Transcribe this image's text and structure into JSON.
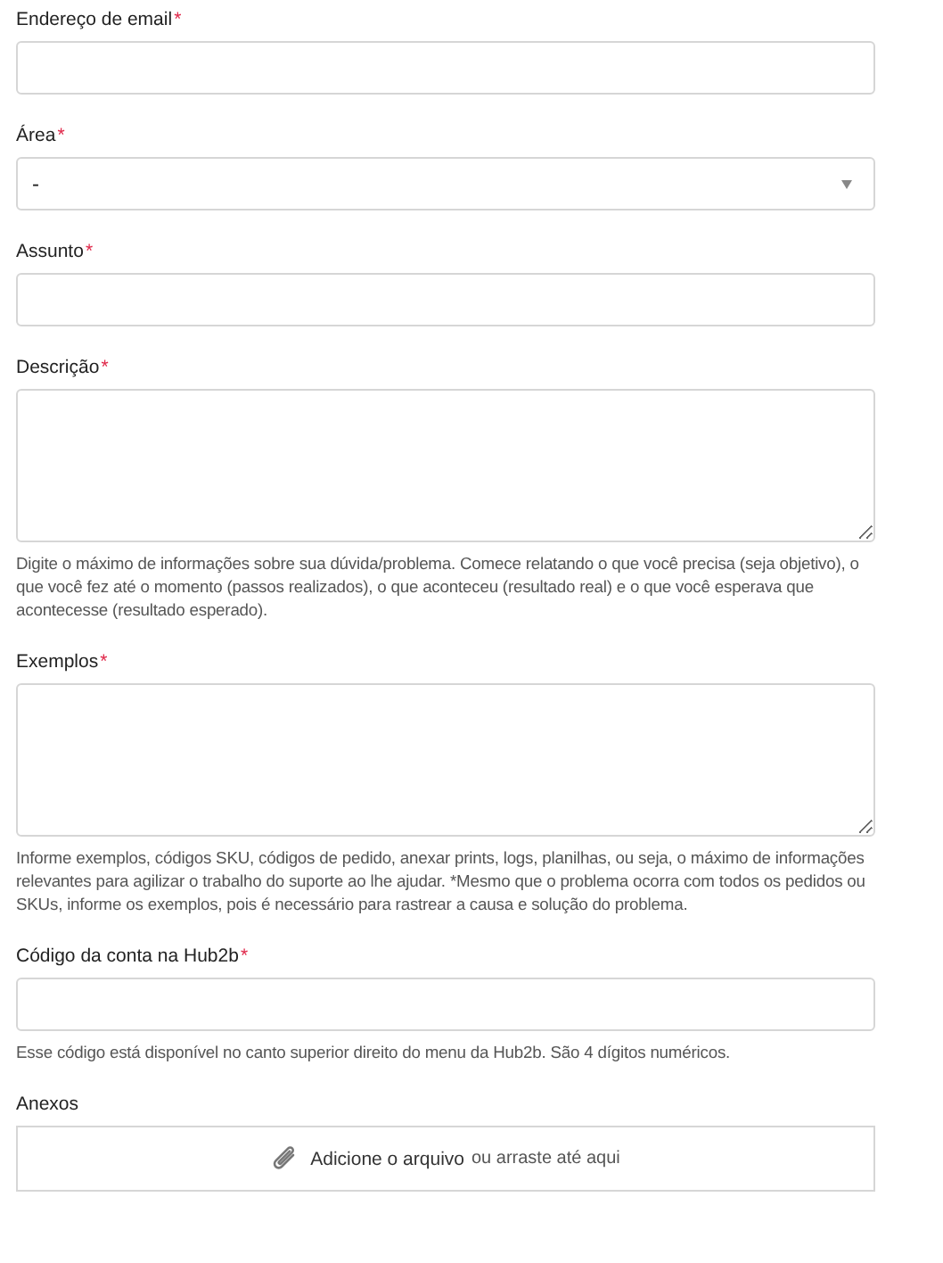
{
  "fields": [
    {
      "kind": "text",
      "label": "Endereço de email",
      "required_mark": "*"
    },
    {
      "kind": "select",
      "label": "Área",
      "required_mark": "*",
      "value": "-"
    },
    {
      "kind": "text",
      "label": "Assunto",
      "required_mark": "*"
    },
    {
      "kind": "textarea",
      "label": "Descrição",
      "required_mark": "*",
      "help": "Digite o máximo de informações sobre sua dúvida/problema. Comece relatando o que você precisa (seja objetivo), o que você fez até o momento (passos realizados), o que aconteceu (resultado real) e o que você esperava que acontecesse (resultado esperado)."
    },
    {
      "kind": "textarea",
      "label": "Exemplos",
      "required_mark": "*",
      "help": "Informe exemplos, códigos SKU, códigos de pedido, anexar prints, logs, planilhas, ou seja, o máximo de informações relevantes para agilizar o trabalho do suporte ao lhe ajudar. *Mesmo que o problema ocorra com todos os pedidos ou SKUs, informe os exemplos, pois é necessário para rastrear a causa e solução do problema."
    },
    {
      "kind": "text",
      "label": "Código da conta na Hub2b",
      "required_mark": "*",
      "help": "Esse código está disponível no canto superior direito do menu da Hub2b. São 4 dígitos numéricos."
    },
    {
      "kind": "file",
      "label": "Anexos",
      "link": "Adicione o arquivo",
      "drop_text": "ou arraste até aqui"
    }
  ]
}
